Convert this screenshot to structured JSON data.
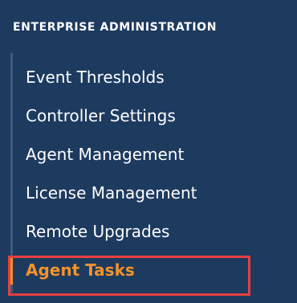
{
  "sidebar": {
    "section_title": "ENTERPRISE ADMINISTRATION",
    "items": [
      {
        "label": "Event Thresholds"
      },
      {
        "label": "Controller Settings"
      },
      {
        "label": "Agent Management"
      },
      {
        "label": "License Management"
      },
      {
        "label": "Remote Upgrades"
      },
      {
        "label": "Agent Tasks",
        "active": true
      }
    ]
  },
  "colors": {
    "panel_background": "#1d3a5f",
    "text": "#ffffff",
    "active_accent": "#f2932a",
    "highlight_border": "#e8403f"
  }
}
